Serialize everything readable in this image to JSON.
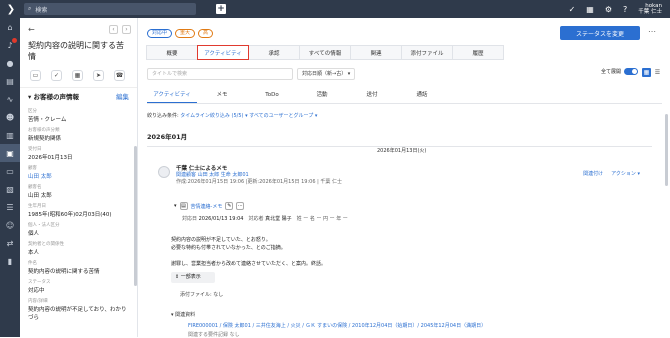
{
  "topbar": {
    "search_placeholder": "検索",
    "user_name": "hokan",
    "user_sub": "千葉 仁士"
  },
  "left": {
    "title": "契約内容の説明に関する苦情",
    "section_title": "お客様の声情報",
    "edit_label": "編集",
    "fields": [
      {
        "k": "区分",
        "v": "苦情・クレーム"
      },
      {
        "k": "お客様の声分類",
        "v": "新規契約関係"
      },
      {
        "k": "受付日",
        "v": "2026年01月13日"
      },
      {
        "k": "顧客",
        "v": "山田 太郎",
        "link": true
      },
      {
        "k": "顧客名",
        "v": "山田 太郎"
      },
      {
        "k": "生年月日",
        "v": "1985年(昭和60年)02月03日(40)"
      },
      {
        "k": "個人・法人区分",
        "v": "個人"
      },
      {
        "k": "契約者との関係性",
        "v": "本人"
      },
      {
        "k": "件名",
        "v": "契約内容の説明に関する苦情"
      },
      {
        "k": "ステータス",
        "v": "対応中"
      },
      {
        "k": "内容/詳細",
        "v": "契約内容の説明が不足しており、わかりづら"
      }
    ]
  },
  "main": {
    "tags": [
      {
        "label": "対応中",
        "c": "blue"
      },
      {
        "label": "重大",
        "c": "orange"
      },
      {
        "label": "高",
        "c": "orange"
      }
    ],
    "status_button": "ステータスを変更",
    "tabs": [
      "概要",
      "アクティビティ",
      "承認",
      "すべての情報",
      "関連",
      "添付ファイル",
      "履歴"
    ],
    "selected_tab": 1,
    "title_placeholder": "タイトルで検索",
    "sort_label": "対応日順（新→古）",
    "expand_label": "全て展開",
    "subtabs": [
      "アクティビティ",
      "メモ",
      "ToDo",
      "活動",
      "送付",
      "通話"
    ],
    "narrow_label": "絞り込み条件:",
    "narrow_timeline": "タイムライン絞り込み (5/5)",
    "narrow_users": "すべてのユーザーとグループ",
    "month": "2026年01月",
    "date": "2026年01月13日(火)",
    "card": {
      "author": "千葉 仁士によるメモ",
      "related": "関連顧客 山田 太郎 生命 太郎01",
      "created": "作成:2026年01月15日 19:06 |更新:2026年01月15日 19:06 | 千葉 仁士",
      "link_label": "関連付け",
      "action_label": "アクション",
      "record_label": "苦情連絡-メモ",
      "meta_date_label": "対応日",
      "meta_date": "2026/01/13 19:04",
      "meta_person_label": "対応者",
      "meta_person": "真北堂 陽子",
      "meta_rest": "姓 ー 名 ー 円 ー 年 ー",
      "body": [
        "契約内容の説明が不足していた、とお怒り。",
        "必要な特約も付帯されていなかった、とのご指摘。",
        "",
        "謝罪し、営業担当者から改めて連絡させていただく、と案内。終話。"
      ],
      "show_btn": "一部表示",
      "attach": "添付ファイル: なし",
      "related_info": "関連資料",
      "related_link": "FIRE000001 / 保険 太郎01 / 三井住友海上 / 火災 / ＧＫ すまいの保険 / 2010年12月04日（始期日）/ 2045年12月04日（満期日）",
      "related_more": "関連する要件記録 なし"
    }
  }
}
